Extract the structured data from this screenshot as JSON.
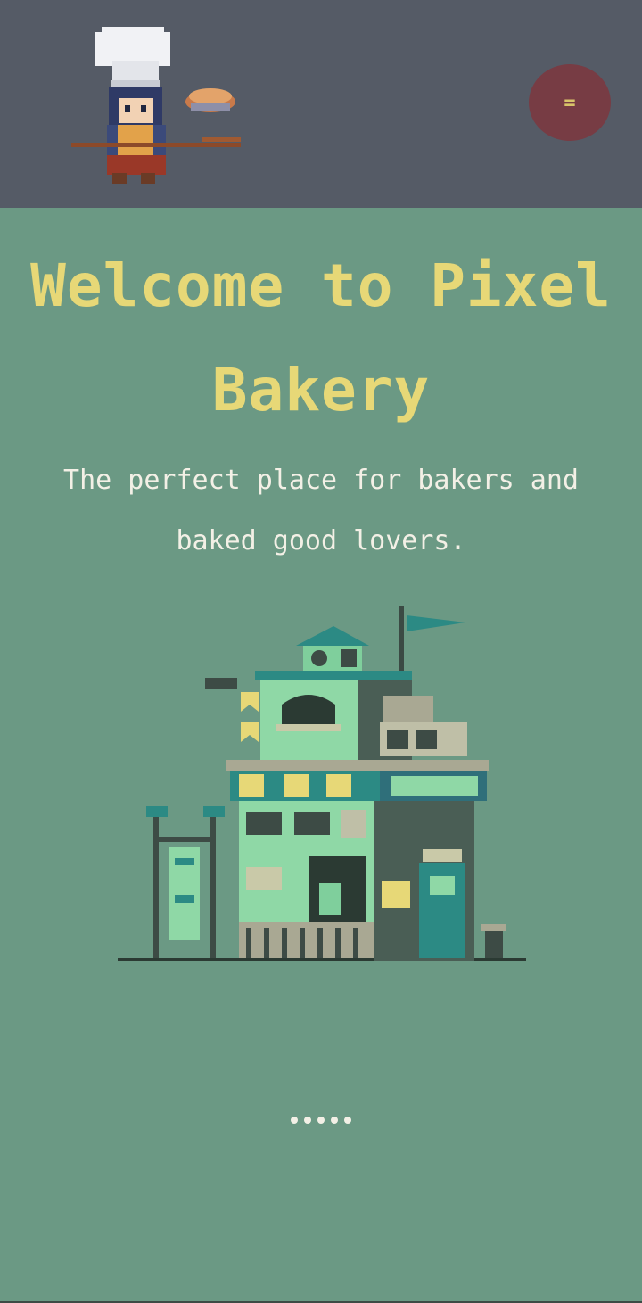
{
  "header": {
    "logo_icon": "baker-chef-holding-pie-icon",
    "menu_button_label": "=",
    "colors": {
      "header_bg": "#555b66",
      "menu_bg": "#773c44"
    }
  },
  "hero": {
    "title_line1": "Welcome to Pixel",
    "title_line2": "Bakery",
    "subtitle_line1": "The perfect place for bakers and",
    "subtitle_line2": "baked good lovers.",
    "illustration_icon": "pixel-bakery-building-icon",
    "colors": {
      "page_bg": "#6b9984",
      "title": "#e7d877",
      "subtitle": "#f3f0e6"
    }
  },
  "carousel": {
    "dot_count": 5
  }
}
